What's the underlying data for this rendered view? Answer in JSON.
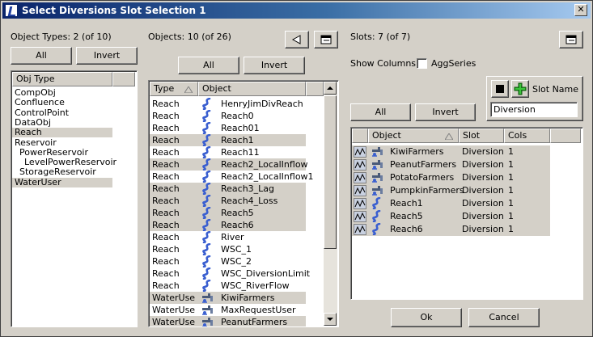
{
  "window": {
    "title": "Select Diversions Slot Selection 1",
    "close_glyph": "✕"
  },
  "left": {
    "label": "Object Types: 2 (of 10)",
    "all_label": "All",
    "invert_label": "Invert",
    "header": "Obj Type",
    "items": [
      {
        "label": "CompObj",
        "selected": false,
        "indent": 0
      },
      {
        "label": "Confluence",
        "selected": false,
        "indent": 0
      },
      {
        "label": "ControlPoint",
        "selected": false,
        "indent": 0
      },
      {
        "label": "DataObj",
        "selected": false,
        "indent": 0
      },
      {
        "label": "Reach",
        "selected": true,
        "indent": 0
      },
      {
        "label": "Reservoir",
        "selected": false,
        "indent": 0
      },
      {
        "label": "PowerReservoir",
        "selected": false,
        "indent": 1
      },
      {
        "label": "LevelPowerReservoir",
        "selected": false,
        "indent": 2
      },
      {
        "label": "StorageReservoir",
        "selected": false,
        "indent": 1
      },
      {
        "label": "WaterUser",
        "selected": true,
        "indent": 0
      }
    ]
  },
  "middle": {
    "label": "Objects: 10 (of 26)",
    "all_label": "All",
    "invert_label": "Invert",
    "col_type": "Type",
    "col_object": "Object",
    "rows": [
      {
        "type": "Reach",
        "object": "HenryJimDivReach",
        "icon": "reach-icon",
        "selected": false
      },
      {
        "type": "Reach",
        "object": "Reach0",
        "icon": "reach-icon",
        "selected": false
      },
      {
        "type": "Reach",
        "object": "Reach01",
        "icon": "reach-icon",
        "selected": false
      },
      {
        "type": "Reach",
        "object": "Reach1",
        "icon": "reach-icon",
        "selected": true
      },
      {
        "type": "Reach",
        "object": "Reach11",
        "icon": "reach-icon",
        "selected": false
      },
      {
        "type": "Reach",
        "object": "Reach2_LocalInflow",
        "icon": "reach-icon",
        "selected": true
      },
      {
        "type": "Reach",
        "object": "Reach2_LocalInflow1",
        "icon": "reach-icon",
        "selected": false
      },
      {
        "type": "Reach",
        "object": "Reach3_Lag",
        "icon": "reach-icon",
        "selected": true
      },
      {
        "type": "Reach",
        "object": "Reach4_Loss",
        "icon": "reach-icon",
        "selected": true
      },
      {
        "type": "Reach",
        "object": "Reach5",
        "icon": "reach-icon",
        "selected": true
      },
      {
        "type": "Reach",
        "object": "Reach6",
        "icon": "reach-icon",
        "selected": true
      },
      {
        "type": "Reach",
        "object": "River",
        "icon": "reach-icon",
        "selected": false
      },
      {
        "type": "Reach",
        "object": "WSC_1",
        "icon": "reach-icon",
        "selected": false
      },
      {
        "type": "Reach",
        "object": "WSC_2",
        "icon": "reach-icon",
        "selected": false
      },
      {
        "type": "Reach",
        "object": "WSC_DiversionLimit",
        "icon": "reach-icon",
        "selected": false
      },
      {
        "type": "Reach",
        "object": "WSC_RiverFlow",
        "icon": "reach-icon",
        "selected": false
      },
      {
        "type": "WaterUse",
        "object": "KiwiFarmers",
        "icon": "water-user-icon",
        "selected": true
      },
      {
        "type": "WaterUse",
        "object": "MaxRequestUser",
        "icon": "water-user-icon",
        "selected": false
      },
      {
        "type": "WaterUse",
        "object": "PeanutFarmers",
        "icon": "water-user-icon",
        "selected": true
      }
    ]
  },
  "right": {
    "label": "Slots: 7 (of 7)",
    "show_columns_label": "Show Columns:",
    "aggseries_label": "AggSeries",
    "all_label": "All",
    "invert_label": "Invert",
    "slot_name_label": "Slot Name",
    "slot_name_value": "Diversion",
    "col_object": "Object",
    "col_slot": "Slot",
    "col_cols": "Cols",
    "rows": [
      {
        "object": "KiwiFarmers",
        "slot": "Diversion",
        "cols": "1",
        "icon": "water-user-icon"
      },
      {
        "object": "PeanutFarmers",
        "slot": "Diversion",
        "cols": "1",
        "icon": "water-user-icon"
      },
      {
        "object": "PotatoFarmers",
        "slot": "Diversion",
        "cols": "1",
        "icon": "water-user-icon"
      },
      {
        "object": "PumpkinFarmers",
        "slot": "Diversion",
        "cols": "1",
        "icon": "water-user-icon"
      },
      {
        "object": "Reach1",
        "slot": "Diversion",
        "cols": "1",
        "icon": "reach-icon"
      },
      {
        "object": "Reach5",
        "slot": "Diversion",
        "cols": "1",
        "icon": "reach-icon"
      },
      {
        "object": "Reach6",
        "slot": "Diversion",
        "cols": "1",
        "icon": "reach-icon"
      }
    ]
  },
  "footer": {
    "ok_label": "Ok",
    "cancel_label": "Cancel"
  }
}
